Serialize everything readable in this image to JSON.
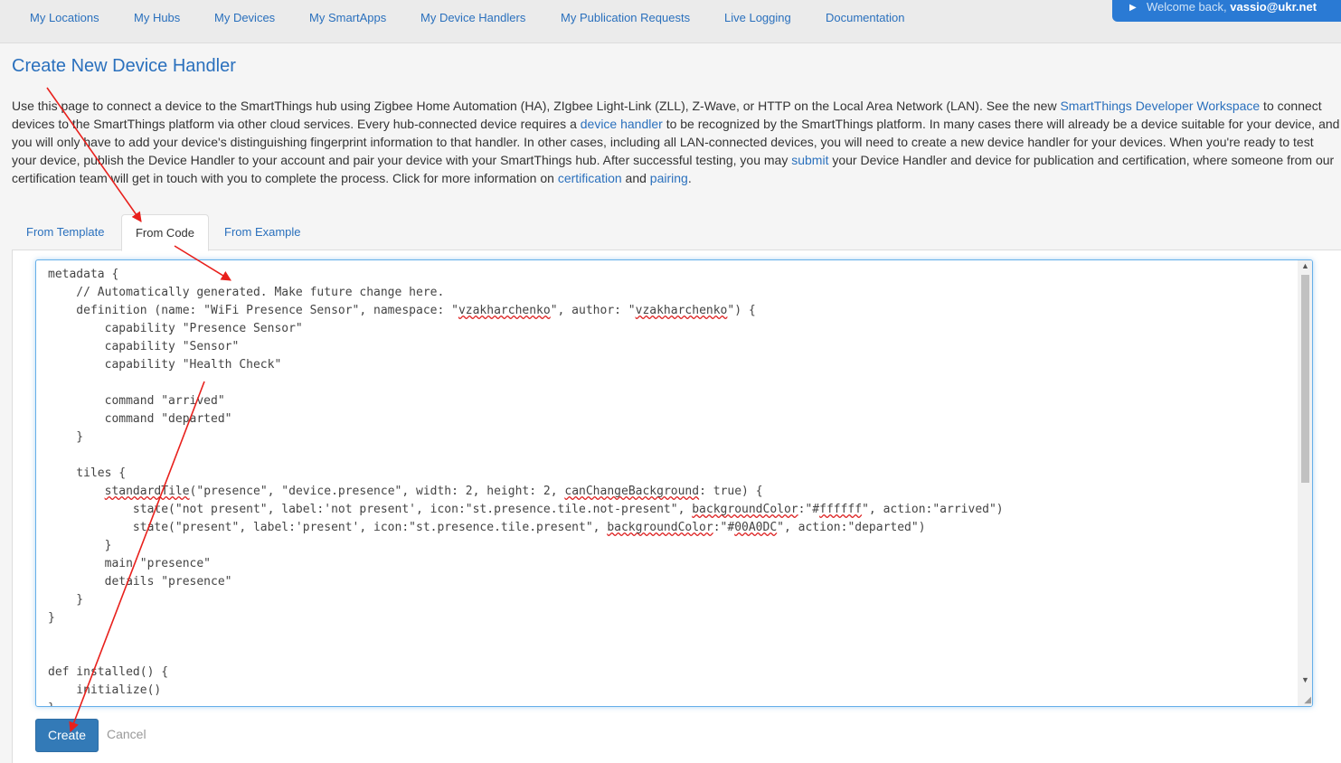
{
  "nav": {
    "items": [
      {
        "label": "My Locations"
      },
      {
        "label": "My Hubs"
      },
      {
        "label": "My Devices"
      },
      {
        "label": "My SmartApps"
      },
      {
        "label": "My Device Handlers"
      },
      {
        "label": "My Publication Requests"
      },
      {
        "label": "Live Logging"
      },
      {
        "label": "Documentation"
      }
    ],
    "welcome_prefix": "Welcome back,",
    "welcome_user": "vassio@ukr.net"
  },
  "page": {
    "title": "Create New Device Handler",
    "intro": {
      "t1": "Use this page to connect a device to the SmartThings hub using Zigbee Home Automation (HA), ZIgbee Light-Link (ZLL), Z-Wave, or HTTP on the Local Area Network (LAN). See the new ",
      "l1": "SmartThings Developer Workspace",
      "t2": " to connect devices to the SmartThings platform via other cloud services. Every hub-connected device requires a ",
      "l2": "device handler",
      "t3": " to be recognized by the SmartThings platform. In many cases there will already be a device suitable for your device, and you will only have to add your device's distinguishing fingerprint information to that handler. In other cases, including all LAN-connected devices, you will need to create a new device handler for your devices. When you're ready to test your device, publish the Device Handler to your account and pair your device with your SmartThings hub. After successful testing, you may ",
      "l3": "submit",
      "t4": " your Device Handler and device for publication and certification, where someone from our certification team will get in touch with you to complete the process. Click for more information on ",
      "l4": "certification",
      "t5": " and ",
      "l5": "pairing",
      "t6": "."
    }
  },
  "tabs": [
    {
      "label": "From Template"
    },
    {
      "label": "From Code"
    },
    {
      "label": "From Example"
    }
  ],
  "editor": {
    "code": {
      "l1": "metadata {",
      "l2": "    // Automatically generated. Make future change here.",
      "l3a": "    definition (name: \"WiFi Presence Sensor\", namespace: \"",
      "l3b": "vzakharchenko",
      "l3c": "\", author: \"",
      "l3d": "vzakharchenko",
      "l3e": "\") {",
      "l4": "        capability \"Presence Sensor\"",
      "l5": "        capability \"Sensor\"",
      "l6": "        capability \"Health Check\"",
      "l7": "",
      "l8": "        command \"arrived\"",
      "l9": "        command \"departed\"",
      "l10": "    }",
      "l11": "",
      "l12": "    tiles {",
      "l13a": "        ",
      "l13b": "standardTile",
      "l13c": "(\"presence\", \"device.presence\", width: 2, height: 2, ",
      "l13d": "canChangeBackground",
      "l13e": ": true) {",
      "l14a": "            state(\"not present\", label:'not present', icon:\"st.presence.tile.not-present\", ",
      "l14b": "backgroundColor",
      "l14c": ":\"#",
      "l14d": "ffffff",
      "l14e": "\", action:\"arrived\")",
      "l15a": "            state(\"present\", label:'present', icon:\"st.presence.tile.present\", ",
      "l15b": "backgroundColor",
      "l15c": ":\"#",
      "l15d": "00A0DC",
      "l15e": "\", action:\"departed\")",
      "l16": "        }",
      "l17": "        main \"presence\"",
      "l18": "        details \"presence\"",
      "l19": "    }",
      "l20": "}",
      "l21": "",
      "l22": "",
      "l23": "def installed() {",
      "l24": "    initialize()",
      "l25": "}"
    }
  },
  "actions": {
    "create_label": "Create",
    "cancel_label": "Cancel"
  },
  "colors": {
    "link": "#2a70bd",
    "primary_button": "#337ab7",
    "welcome_bg": "#2a7ad4",
    "annotation_arrow": "#e8201c"
  }
}
